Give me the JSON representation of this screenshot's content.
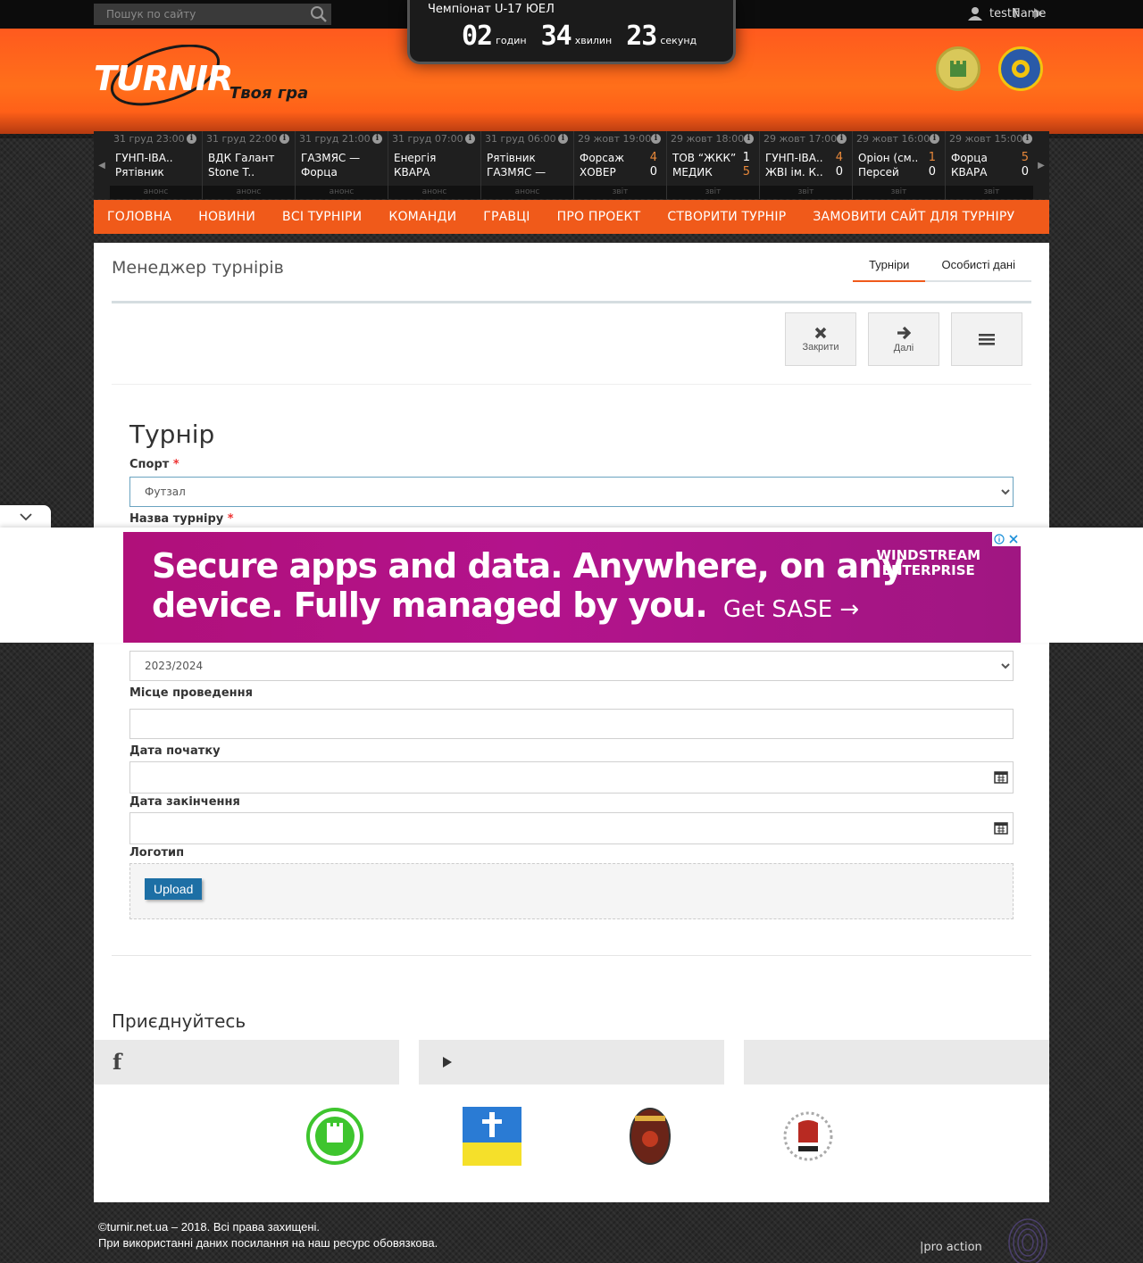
{
  "search": {
    "placeholder": "Пошук по сайту"
  },
  "user": {
    "name": "testName"
  },
  "countdown": {
    "title": "Чемпіонат U-17 ЮЕЛ",
    "hours": "02",
    "hours_label": "годин",
    "minutes": "34",
    "minutes_label": "хвилин",
    "seconds": "23",
    "seconds_label": "секунд"
  },
  "logo": {
    "text": "TURNIR",
    "tagline": "Твоя гра"
  },
  "ticker": [
    {
      "date": "31 груд 23:00",
      "team1": "ГУНП-ІВА..",
      "team2": "Рятівник",
      "score1": "",
      "score2": "",
      "status": "анонс"
    },
    {
      "date": "31 груд 22:00",
      "team1": "ВДК Галант",
      "team2": "Stone T..",
      "score1": "",
      "score2": "",
      "status": "анонс"
    },
    {
      "date": "31 груд 21:00",
      "team1": "ГАЗМЯС —",
      "team2": "Форца",
      "score1": "",
      "score2": "",
      "status": "анонс"
    },
    {
      "date": "31 груд 07:00",
      "team1": "Енергія",
      "team2": "КВАРА",
      "score1": "",
      "score2": "",
      "status": "анонс"
    },
    {
      "date": "31 груд 06:00",
      "team1": "Рятівник",
      "team2": "ГАЗМЯС —",
      "score1": "",
      "score2": "",
      "status": "анонс"
    },
    {
      "date": "29 жовт 19:00",
      "team1": "Форсаж",
      "team2": "ХОВЕР",
      "score1": "4",
      "score2": "0",
      "status": "звіт",
      "s1win": true
    },
    {
      "date": "29 жовт 18:00",
      "team1": "ТОВ “ЖКК”",
      "team2": "МЕДИК",
      "score1": "1",
      "score2": "5",
      "status": "звіт",
      "s1win": false
    },
    {
      "date": "29 жовт 17:00",
      "team1": "ГУНП-ІВА..",
      "team2": "ЖВІ ім. К..",
      "score1": "4",
      "score2": "0",
      "status": "звіт",
      "s1win": true
    },
    {
      "date": "29 жовт 16:00",
      "team1": "Оріон (см..",
      "team2": "Персей",
      "score1": "1",
      "score2": "0",
      "status": "звіт",
      "s1win": true
    },
    {
      "date": "29 жовт 15:00",
      "team1": "Форца",
      "team2": "КВАРА",
      "score1": "5",
      "score2": "0",
      "status": "звіт",
      "s1win": true
    }
  ],
  "nav": [
    "Головна",
    "Новини",
    "Всі турніри",
    "Команди",
    "Гравці",
    "Про проект",
    "Створити турнір",
    "Замовити сайт для турніру"
  ],
  "page": {
    "title": "Менеджер турнірів",
    "tabs": [
      "Турніри",
      "Особисті дані"
    ]
  },
  "toolbar": {
    "close": "Закрити",
    "next": "Далі"
  },
  "form": {
    "heading": "Турнір",
    "sport_label": "Спорт",
    "sport_value": "Футзал",
    "name_label": "Назва турніру",
    "season_value": "2023/2024",
    "venue_label": "Місце проведення",
    "start_label": "Дата початку",
    "end_label": "Дата закінчення",
    "logo_label": "Логотип",
    "upload": "Upload"
  },
  "join": {
    "title": "Приєднуйтесь"
  },
  "ad": {
    "line1": "Secure apps and data. Anywhere, on any",
    "line2": "device. Fully managed by you.",
    "cta": "Get SASE →",
    "brand1": "WINDSTREAM",
    "brand2": "ENTERPRISE"
  },
  "footer": {
    "line1": "©turnir.net.ua – 2018. Всі права захищені.",
    "line2": "При використанні даних посилання на наш ресурс обовязкова.",
    "partner": "|pro action"
  },
  "colors": {
    "accent": "#f05a1a",
    "win": "#e8883a",
    "lose": "#ffffff"
  }
}
